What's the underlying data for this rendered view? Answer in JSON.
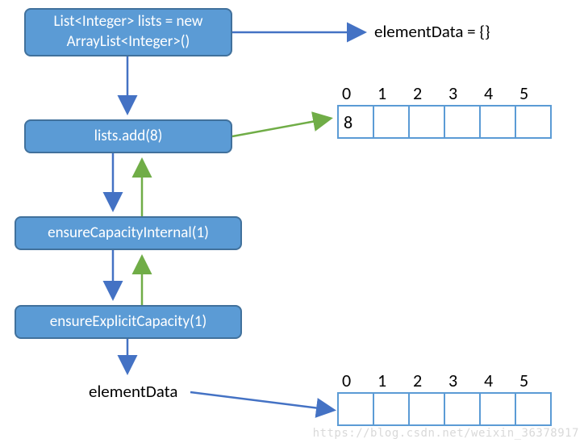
{
  "boxes": {
    "init": "List<Integer> lists = new\nArrayList<Integer>()",
    "add": "lists.add(8)",
    "ensureInternal": "ensureCapacityInternal(1)",
    "ensureExplicit": "ensureExplicitCapacity(1)"
  },
  "labels": {
    "elementDataInit": "elementData = {}",
    "elementDataFinal": "elementData"
  },
  "array1": {
    "indices": [
      "0",
      "1",
      "2",
      "3",
      "4",
      "5"
    ],
    "values": [
      "8",
      "",
      "",
      "",
      "",
      ""
    ]
  },
  "array2": {
    "indices": [
      "0",
      "1",
      "2",
      "3",
      "4",
      "5"
    ],
    "values": [
      "",
      "",
      "",
      "",
      "",
      ""
    ]
  },
  "watermark": "https://blog.csdn.net/weixin_36378917",
  "colors": {
    "boxFill": "#5b9bd5",
    "boxBorder": "#41719c",
    "blueArrow": "#4472c4",
    "greenArrow": "#70ad47"
  }
}
